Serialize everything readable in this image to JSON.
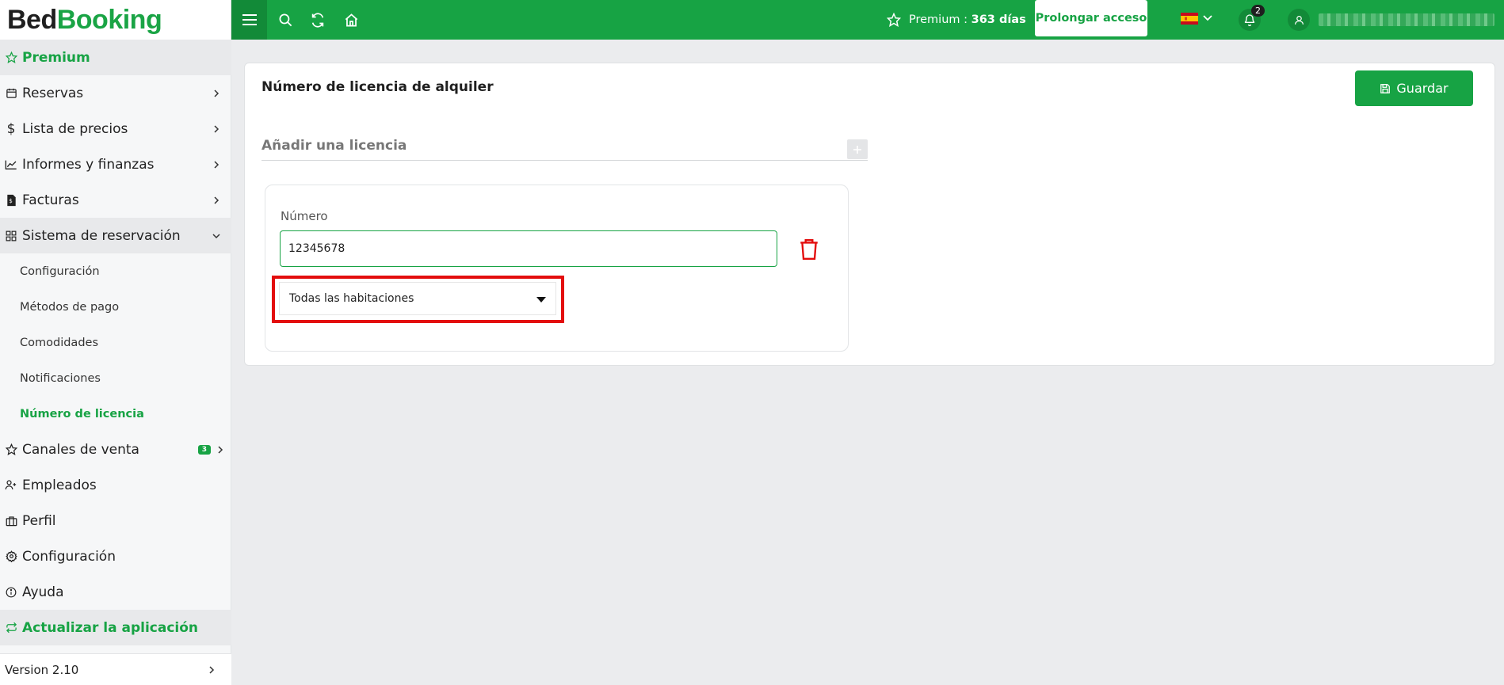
{
  "brand": {
    "part1": "Bed",
    "part2": "Booking"
  },
  "sidebar": {
    "premium": "Premium",
    "items": [
      {
        "label": "Reservas",
        "icon": "calendar-icon"
      },
      {
        "label": "Lista de precios",
        "icon": "dollar-icon"
      },
      {
        "label": "Informes y finanzas",
        "icon": "chart-line-icon"
      },
      {
        "label": "Facturas",
        "icon": "invoice-icon"
      },
      {
        "label": "Sistema de reservación",
        "icon": "grid-icon"
      }
    ],
    "subitems": [
      "Configuración",
      "Métodos de pago",
      "Comodidades",
      "Notificaciones",
      "Número de licencia"
    ],
    "items2": [
      {
        "label": "Canales de venta",
        "badge": "3",
        "icon": "star-icon"
      },
      {
        "label": "Empleados",
        "icon": "user-plus-icon"
      },
      {
        "label": "Perfil",
        "icon": "briefcase-icon"
      },
      {
        "label": "Configuración",
        "icon": "gear-icon"
      },
      {
        "label": "Ayuda",
        "icon": "info-icon"
      }
    ],
    "update": "Actualizar la aplicación",
    "version": "Version 2.10"
  },
  "topbar": {
    "premium_label": "Premium :",
    "premium_days": "363 días",
    "prolongar": "Prolongar acceso",
    "notifications_count": "2"
  },
  "page": {
    "title": "Número de licencia de alquiler",
    "save_label": "Guardar",
    "add_label": "Añadir una licencia",
    "number_label": "Número",
    "number_value": "12345678",
    "rooms_select": "Todas las habitaciones"
  },
  "colors": {
    "accent": "#17a344",
    "highlight": "#e30d0d"
  }
}
